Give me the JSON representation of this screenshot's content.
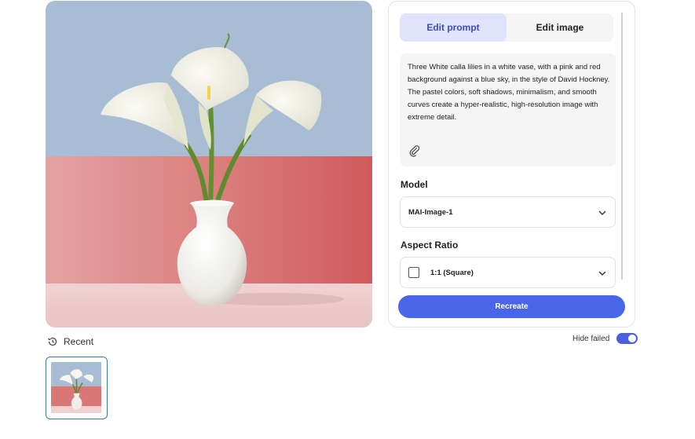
{
  "tabs": [
    {
      "label": "Edit prompt",
      "active": true
    },
    {
      "label": "Edit image",
      "active": false
    }
  ],
  "prompt": {
    "text": "Three White calla lilies in a white vase, with a pink and red background against a blue sky, in the style of David Hockney. The pastel colors, soft shadows, minimalism, and smooth curves create a hyper-realistic, high-resolution image with extreme detail.",
    "attach_icon": "paperclip-icon"
  },
  "model": {
    "label": "Model",
    "selected": "MAI-Image-1"
  },
  "aspect_ratio": {
    "label": "Aspect Ratio",
    "selected": "1:1 (Square)"
  },
  "actions": {
    "recreate_label": "Recreate"
  },
  "history": {
    "recent_label": "Recent",
    "hide_failed_label": "Hide failed",
    "hide_failed_on": true
  },
  "colors": {
    "accent": "#4a66e8",
    "tab_active_bg": "#dfe3fb",
    "sky": "#a9bcd2",
    "wall": "#d9706f",
    "floor": "#efcfcf"
  }
}
